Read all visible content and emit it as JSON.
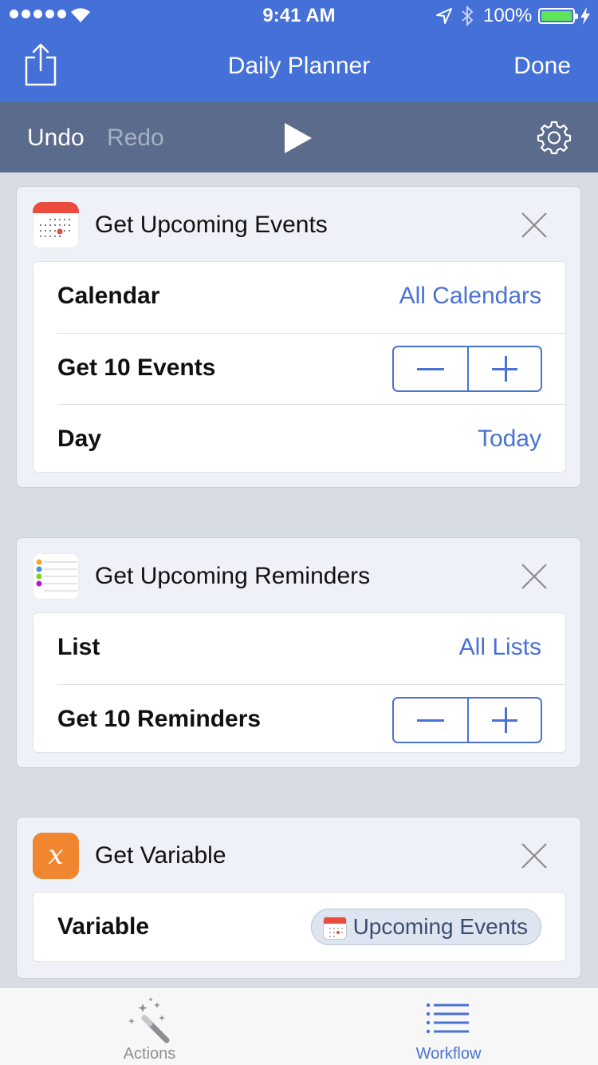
{
  "status_bar": {
    "time": "9:41 AM",
    "battery": "100%"
  },
  "nav": {
    "title": "Daily Planner",
    "done_label": "Done"
  },
  "toolbar": {
    "undo_label": "Undo",
    "redo_label": "Redo"
  },
  "actions": [
    {
      "title": "Get Upcoming Events",
      "rows": [
        {
          "label": "Calendar",
          "value": "All Calendars"
        },
        {
          "label": "Get 10 Events"
        },
        {
          "label": "Day",
          "value": "Today"
        }
      ]
    },
    {
      "title": "Get Upcoming Reminders",
      "rows": [
        {
          "label": "List",
          "value": "All Lists"
        },
        {
          "label": "Get 10 Reminders"
        }
      ]
    },
    {
      "title": "Get Variable",
      "icon_glyph": "x",
      "rows": [
        {
          "label": "Variable",
          "token": "Upcoming Events"
        }
      ]
    }
  ],
  "tabbar": {
    "tabs": [
      {
        "label": "Actions",
        "active": false
      },
      {
        "label": "Workflow",
        "active": true
      }
    ]
  },
  "colors": {
    "nav_bg": "#4470d8",
    "toolbar_bg": "#5a6b8b",
    "accent": "#4a72d4",
    "inactive_tab": "#8e8e93",
    "variable_icon": "#f0862f"
  },
  "icons": {
    "share": "share-icon",
    "play": "play-icon",
    "settings": "gear-icon",
    "close": "close-icon",
    "calendar": "calendar-app-icon",
    "reminders": "reminders-app-icon",
    "variable": "variable-icon",
    "actions_tab": "magic-wand-icon",
    "workflow_tab": "list-icon"
  }
}
